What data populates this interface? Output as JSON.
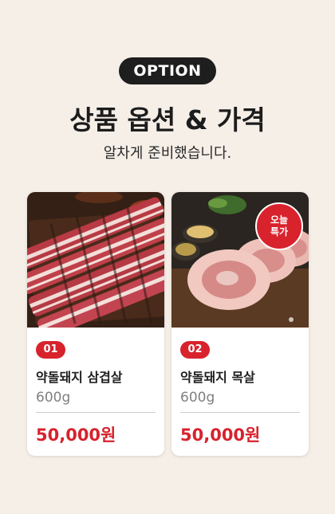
{
  "header": {
    "option_label": "OPTION",
    "title": "상품 옵션 & 가격",
    "subtitle": "알차게 준비했습니다."
  },
  "products": [
    {
      "number": "01",
      "name": "약돌돼지 삼겹살",
      "weight": "600g",
      "price": "50,000원",
      "image_icon": "pork-belly-photo"
    },
    {
      "number": "02",
      "name": "약돌돼지 목살",
      "weight": "600g",
      "price": "50,000원",
      "badge": "오늘 특가",
      "image_icon": "pork-neck-photo"
    }
  ],
  "colors": {
    "background": "#f5efe8",
    "accent_red": "#d8222c",
    "pill_dark": "#1e1e1e"
  }
}
